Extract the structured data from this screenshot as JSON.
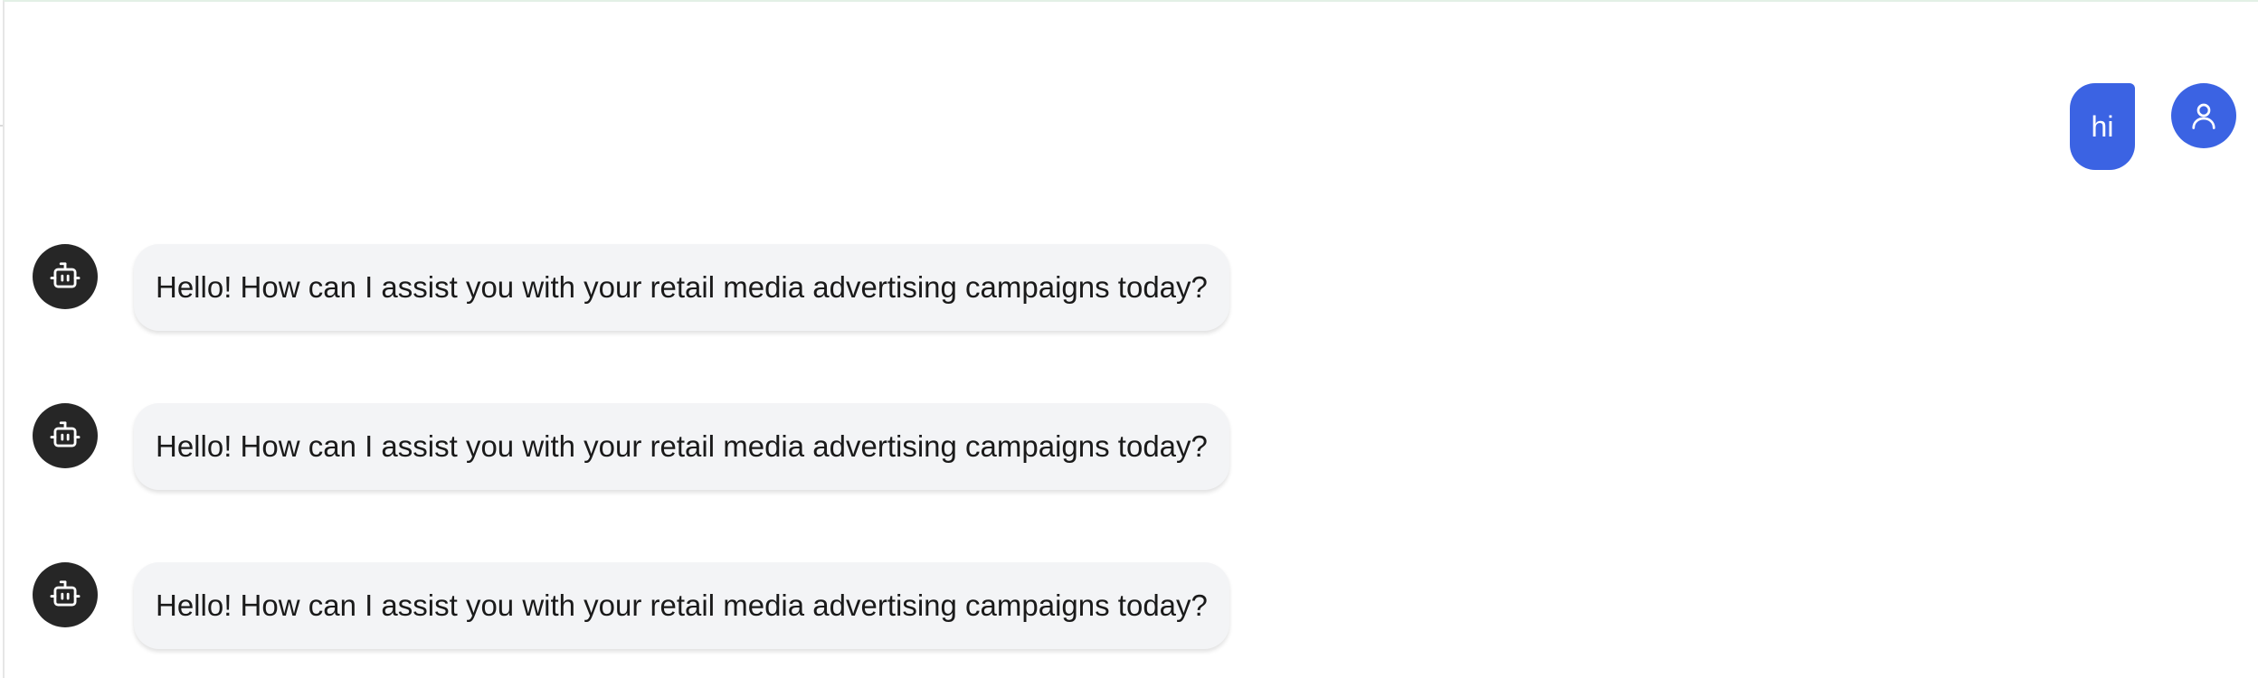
{
  "chat": {
    "user_message": {
      "text": "hi",
      "avatar_icon": "user-icon",
      "color": "#3b63e3"
    },
    "bot_avatar_icon": "robot-icon",
    "bot_messages": [
      {
        "text": "Hello! How can I assist you with your retail media advertising campaigns today?"
      },
      {
        "text": "Hello! How can I assist you with your retail media advertising campaigns today?"
      },
      {
        "text": "Hello! How can I assist you with your retail media advertising campaigns today?"
      }
    ]
  }
}
